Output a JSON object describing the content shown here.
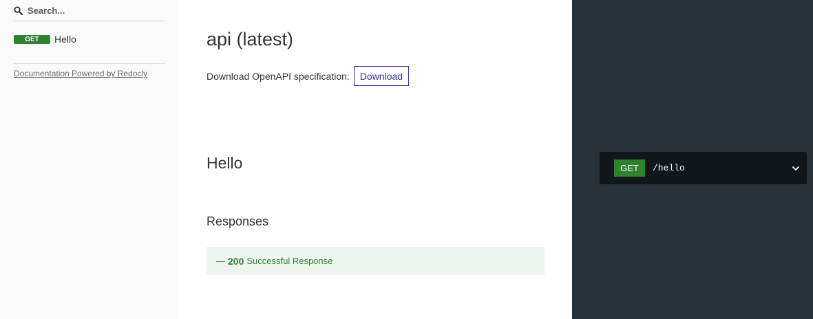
{
  "sidebar": {
    "search_placeholder": "Search...",
    "items": [
      {
        "method": "GET",
        "label": "Hello"
      }
    ],
    "powered_by": "Documentation Powered by Redocly"
  },
  "main": {
    "title": "api (latest)",
    "download_label": "Download OpenAPI specification:",
    "download_button": "Download",
    "operation": {
      "title": "Hello",
      "responses_heading": "Responses",
      "responses": [
        {
          "dash": "—",
          "code": "200",
          "description": "Successful Response"
        }
      ]
    }
  },
  "right_panel": {
    "method": "GET",
    "path": "/hello"
  },
  "colors": {
    "get_badge": "#2f8132",
    "sidebar_bg": "#fafafa",
    "right_panel_bg": "#263238",
    "endpoint_bg": "#11171a",
    "response_bg": "#edf5ee",
    "link_accent": "#32329f"
  },
  "icons": {
    "search": "search-icon",
    "chevron": "chevron-down-icon"
  }
}
